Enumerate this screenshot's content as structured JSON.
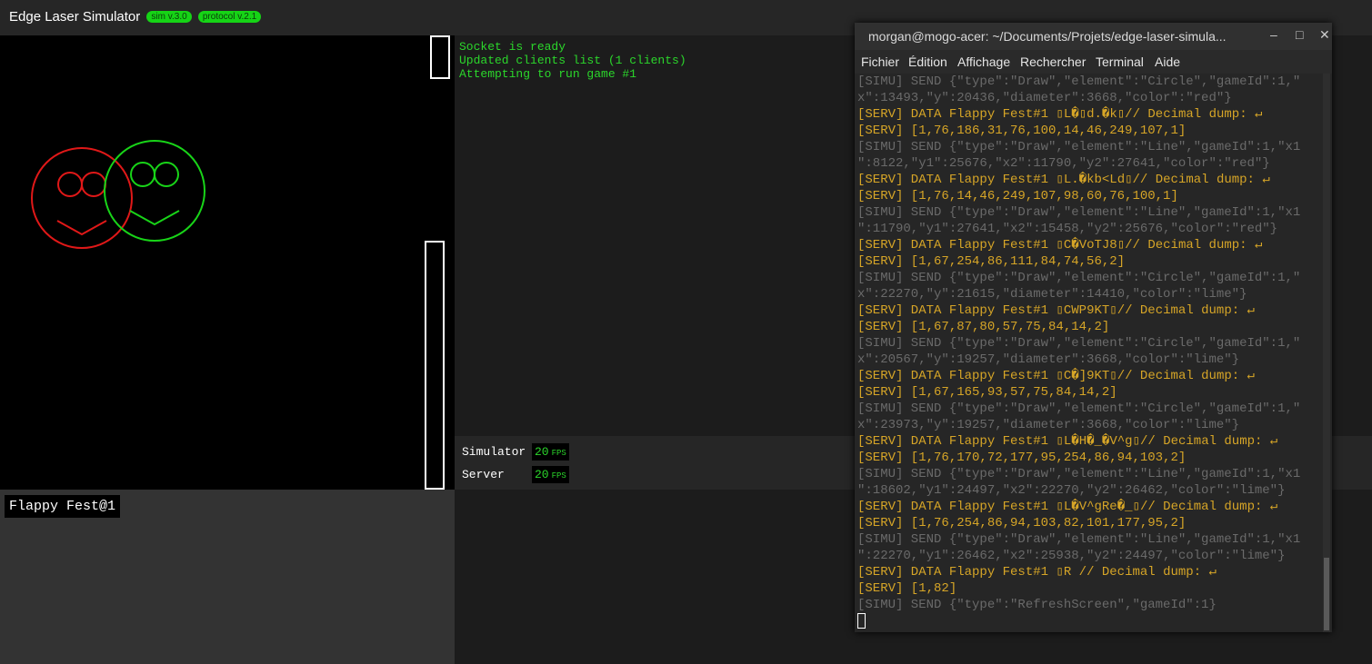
{
  "app": {
    "title": "Edge Laser Simulator",
    "sim_badge": "sim v.3.0",
    "protocol_badge": "protocol v.2.1"
  },
  "game": {
    "label": "Flappy Fest@1"
  },
  "log": [
    "Socket is ready",
    "Updated clients list (1 clients)",
    "Attempting to run game #1"
  ],
  "fps": {
    "simulator": {
      "label": "Simulator",
      "value": "20",
      "unit": "FPS"
    },
    "server": {
      "label": "Server",
      "value": "20",
      "unit": "FPS"
    }
  },
  "terminal": {
    "title": "morgan@mogo-acer: ~/Documents/Projets/edge-laser-simula...",
    "controls": {
      "minimize": "–",
      "maximize": "□",
      "close": "✕"
    },
    "menu": [
      "Fichier",
      "Édition",
      "Affichage",
      "Rechercher",
      "Terminal",
      "Aide"
    ],
    "lines": [
      {
        "kind": "simu",
        "text": "[SIMU] SEND {\"type\":\"Draw\",\"element\":\"Circle\",\"gameId\":1,\""
      },
      {
        "kind": "simu",
        "text": "x\":13493,\"y\":20436,\"diameter\":3668,\"color\":\"red\"}"
      },
      {
        "kind": "serv",
        "text": "[SERV] DATA Flappy Fest#1 ▯L�▯d.�k▯// Decimal dump: ↵"
      },
      {
        "kind": "serv",
        "text": "[SERV] [1,76,186,31,76,100,14,46,249,107,1]"
      },
      {
        "kind": "simu",
        "text": "[SIMU] SEND {\"type\":\"Draw\",\"element\":\"Line\",\"gameId\":1,\"x1"
      },
      {
        "kind": "simu",
        "text": "\":8122,\"y1\":25676,\"x2\":11790,\"y2\":27641,\"color\":\"red\"}"
      },
      {
        "kind": "serv",
        "text": "[SERV] DATA Flappy Fest#1 ▯L.�kb<Ld▯// Decimal dump: ↵"
      },
      {
        "kind": "serv",
        "text": "[SERV] [1,76,14,46,249,107,98,60,76,100,1]"
      },
      {
        "kind": "simu",
        "text": "[SIMU] SEND {\"type\":\"Draw\",\"element\":\"Line\",\"gameId\":1,\"x1"
      },
      {
        "kind": "simu",
        "text": "\":11790,\"y1\":27641,\"x2\":15458,\"y2\":25676,\"color\":\"red\"}"
      },
      {
        "kind": "serv",
        "text": "[SERV] DATA Flappy Fest#1 ▯C�VoTJ8▯// Decimal dump: ↵"
      },
      {
        "kind": "serv",
        "text": "[SERV] [1,67,254,86,111,84,74,56,2]"
      },
      {
        "kind": "simu",
        "text": "[SIMU] SEND {\"type\":\"Draw\",\"element\":\"Circle\",\"gameId\":1,\""
      },
      {
        "kind": "simu",
        "text": "x\":22270,\"y\":21615,\"diameter\":14410,\"color\":\"lime\"}"
      },
      {
        "kind": "serv",
        "text": "[SERV] DATA Flappy Fest#1 ▯CWP9KT▯// Decimal dump: ↵"
      },
      {
        "kind": "serv",
        "text": "[SERV] [1,67,87,80,57,75,84,14,2]"
      },
      {
        "kind": "simu",
        "text": "[SIMU] SEND {\"type\":\"Draw\",\"element\":\"Circle\",\"gameId\":1,\""
      },
      {
        "kind": "simu",
        "text": "x\":20567,\"y\":19257,\"diameter\":3668,\"color\":\"lime\"}"
      },
      {
        "kind": "serv",
        "text": "[SERV] DATA Flappy Fest#1 ▯C�]9KT▯// Decimal dump: ↵"
      },
      {
        "kind": "serv",
        "text": "[SERV] [1,67,165,93,57,75,84,14,2]"
      },
      {
        "kind": "simu",
        "text": "[SIMU] SEND {\"type\":\"Draw\",\"element\":\"Circle\",\"gameId\":1,\""
      },
      {
        "kind": "simu",
        "text": "x\":23973,\"y\":19257,\"diameter\":3668,\"color\":\"lime\"}"
      },
      {
        "kind": "serv",
        "text": "[SERV] DATA Flappy Fest#1 ▯L�H�_�V^g▯// Decimal dump: ↵"
      },
      {
        "kind": "serv",
        "text": "[SERV] [1,76,170,72,177,95,254,86,94,103,2]"
      },
      {
        "kind": "simu",
        "text": "[SIMU] SEND {\"type\":\"Draw\",\"element\":\"Line\",\"gameId\":1,\"x1"
      },
      {
        "kind": "simu",
        "text": "\":18602,\"y1\":24497,\"x2\":22270,\"y2\":26462,\"color\":\"lime\"}"
      },
      {
        "kind": "serv",
        "text": "[SERV] DATA Flappy Fest#1 ▯L�V^gRe�_▯// Decimal dump: ↵"
      },
      {
        "kind": "serv",
        "text": "[SERV] [1,76,254,86,94,103,82,101,177,95,2]"
      },
      {
        "kind": "simu",
        "text": "[SIMU] SEND {\"type\":\"Draw\",\"element\":\"Line\",\"gameId\":1,\"x1"
      },
      {
        "kind": "simu",
        "text": "\":22270,\"y1\":26462,\"x2\":25938,\"y2\":24497,\"color\":\"lime\"}"
      },
      {
        "kind": "serv",
        "text": "[SERV] DATA Flappy Fest#1 ▯R // Decimal dump: ↵"
      },
      {
        "kind": "serv",
        "text": "[SERV] [1,82]"
      },
      {
        "kind": "simu",
        "text": "[SIMU] SEND {\"type\":\"RefreshScreen\",\"gameId\":1}"
      }
    ]
  },
  "colors": {
    "accent_green": "#16d416",
    "log_green": "#2bd62b",
    "serv_orange": "#d6a527",
    "simu_gray": "#6a6a6a"
  }
}
